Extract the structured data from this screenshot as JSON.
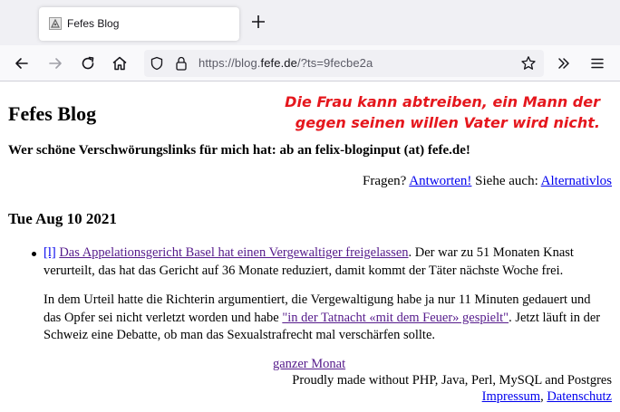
{
  "browser": {
    "tab_title": "Fefes Blog",
    "url_prefix": "https://blog.",
    "url_host": "fefe.de",
    "url_rest": "/?ts=9fecbe2a"
  },
  "icons": {
    "favicon": "fefe-favicon",
    "new_tab": "plus-icon",
    "back": "arrow-left-icon",
    "forward": "arrow-right-icon",
    "reload": "reload-icon",
    "home": "home-icon",
    "tracking": "shield-icon",
    "security": "lock-icon",
    "bookmark": "star-icon",
    "overflow": "chevron-double-right-icon",
    "menu": "hamburger-menu-icon"
  },
  "page": {
    "title": "Fefes Blog",
    "overlay_caption": "Die Frau kann abtreiben, ein Mann der gegen seinen willen Vater wird nicht.",
    "tagline": "Wer schöne Verschwörungslinks für mich hat: ab an felix-bloginput (at) fefe.de!",
    "links_prefix": "Fragen?",
    "answers_link": "Antworten!",
    "links_middle": "Siehe auch:",
    "alternativlos_link": "Alternativlos",
    "date": "Tue Aug 10 2021"
  },
  "post": {
    "permalink": "[l]",
    "headline_link": "Das Appelationsgericht Basel hat einen Vergewaltiger freigelassen",
    "text1": ". Der war zu 51 Monaten Knast verurteilt, das hat das Gericht auf 36 Monate reduziert, damit kommt der Täter nächste Woche frei.",
    "text2_a": "In dem Urteil hatte die Richterin argumentiert, die Vergewaltigung habe ja nur 11 Minuten gedauert und das Opfer sei nicht verletzt worden und habe ",
    "quote_link": "\"in der Tatnacht «mit dem Feuer» gespielt\"",
    "text2_b": ". Jetzt läuft in der Schweiz eine Debatte, ob man das Sexualstrafrecht mal verschärfen sollte."
  },
  "footer": {
    "month_link": "ganzer Monat",
    "made_with": "Proudly made without PHP, Java, Perl, MySQL and Postgres",
    "impressum": "Impressum",
    "separator": ", ",
    "datenschutz": "Datenschutz"
  },
  "colors": {
    "overlay_red": "#e5171d",
    "link": "#0000ee",
    "visited_link": "#551a8b",
    "chrome_bg": "#f0f0f4"
  }
}
